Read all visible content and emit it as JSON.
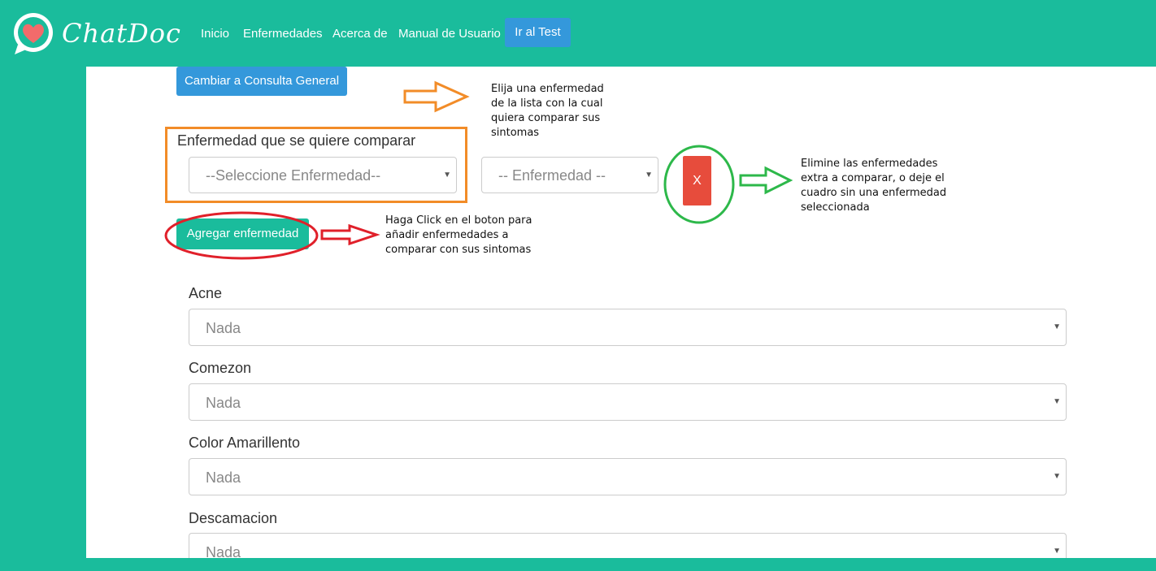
{
  "navbar": {
    "brand": "ChatDoc",
    "links": [
      "Inicio",
      "Enfermedades",
      "Acerca de",
      "Manual de Usuario"
    ],
    "test_button": "Ir al Test"
  },
  "main": {
    "general_button": "Cambiar a Consulta General",
    "compare_label": "Enfermedad que se quiere comparar",
    "select_disease_placeholder": "--Seleccione Enfermedad--",
    "extra_disease_placeholder": "-- Enfermedad --",
    "remove_button": "X",
    "add_button": "Agregar enfermedad",
    "symptoms": [
      {
        "label": "Acne",
        "value": "Nada"
      },
      {
        "label": "Comezon",
        "value": "Nada"
      },
      {
        "label": "Color Amarillento",
        "value": "Nada"
      },
      {
        "label": "Descamacion",
        "value": "Nada"
      }
    ]
  },
  "annotations": {
    "choose_note": [
      "Elija una enfermedad",
      "de la lista con la cual",
      "quiera comparar sus",
      "sintomas"
    ],
    "add_note": [
      "Haga Click en el boton para",
      "añadir enfermedades a",
      "comparar con sus sintomas"
    ],
    "remove_note": [
      "Elimine las enfermedades",
      "extra a comparar, o deje el",
      "cuadro sin una enfermedad",
      "seleccionada"
    ]
  },
  "icons": {
    "logo": "heart-chat-bubble-icon",
    "select_caret": "caret-down-icon"
  },
  "colors": {
    "brand": "#1abc9c",
    "primary": "#3498db",
    "danger": "#e74c3c",
    "annotation_orange": "#f28c28",
    "annotation_red": "#e0202a",
    "annotation_green": "#2db84a"
  }
}
